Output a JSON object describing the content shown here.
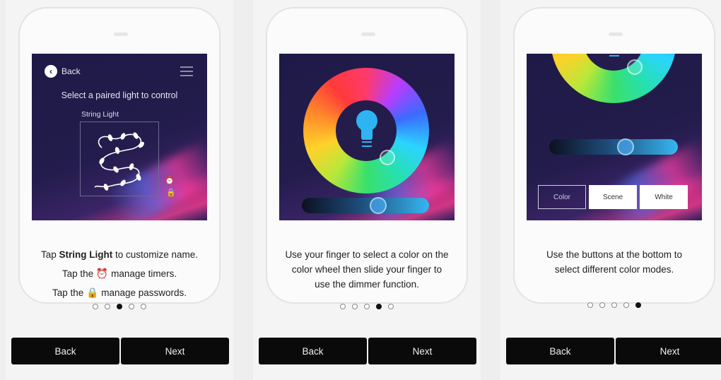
{
  "panels": [
    {
      "screen": {
        "back_label": "Back",
        "title": "Select a paired light to control",
        "light_name": "String Light"
      },
      "desc": {
        "line1_pre": "Tap ",
        "line1_bold": "String Light",
        "line1_post": " to customize name.",
        "line2_pre": "Tap the ",
        "line2_post": " manage timers.",
        "line3_pre": "Tap the ",
        "line3_post": " manage passwords."
      },
      "active_dot": 3,
      "nav": {
        "back": "Back",
        "next": "Next"
      }
    },
    {
      "desc": {
        "line1": "Use your finger to select a color on the",
        "line2": "color wheel then slide your finger to",
        "line3": "use the dimmer function."
      },
      "active_dot": 4,
      "nav": {
        "back": "Back",
        "next": "Next"
      }
    },
    {
      "screen": {
        "modes": [
          "Color",
          "Scene",
          "White"
        ],
        "active_mode": "Color"
      },
      "desc": {
        "line1": "Use the buttons at the bottom to",
        "line2": "select different color modes."
      },
      "active_dot": 5,
      "nav": {
        "back": "Back",
        "next": "Next"
      }
    }
  ],
  "dot_count": 5,
  "icons": {
    "back": "back-arrow-icon",
    "menu": "hamburger-menu-icon",
    "timer": "alarm-clock-icon",
    "lock": "lock-icon",
    "bulb": "light-bulb-icon"
  },
  "colors": {
    "screen_bg": "#1e1a47",
    "bulb": "#2eb4f2",
    "nav_bg": "#0a0a0a"
  }
}
